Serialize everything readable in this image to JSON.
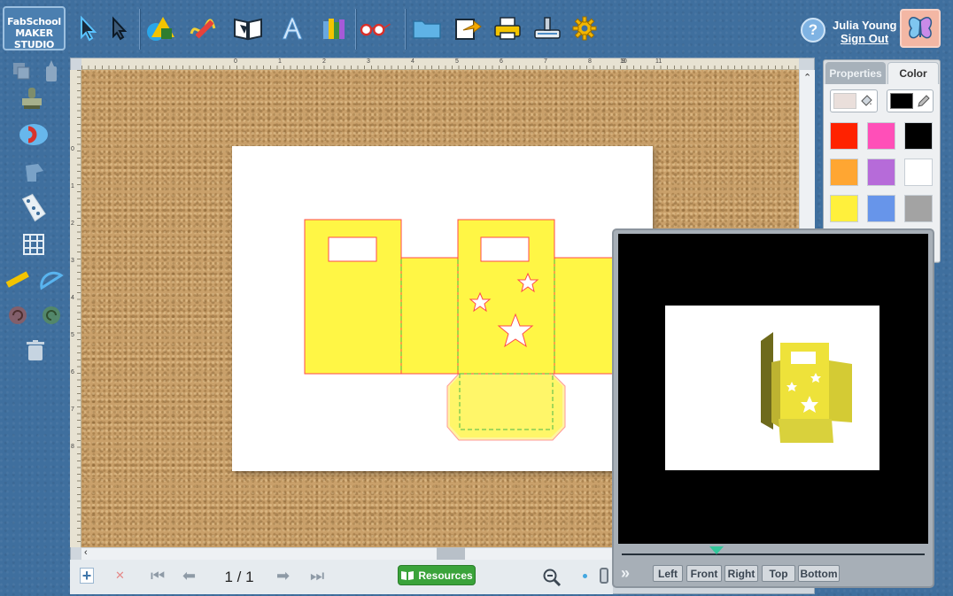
{
  "app": {
    "logo_line1": "FabSchool",
    "logo_line2": "MAKER STUDIO"
  },
  "toolbar": {
    "tools": [
      {
        "name": "select-tool",
        "icon": "arrow-pointer-icon"
      },
      {
        "name": "direct-select-tool",
        "icon": "hollow-arrow-icon"
      },
      {
        "name": "shapes-tool",
        "icon": "shapes-icon"
      },
      {
        "name": "draw-tool",
        "icon": "pencil-squiggle-icon"
      },
      {
        "name": "templates-tool",
        "icon": "open-book-icon"
      },
      {
        "name": "text-tool",
        "icon": "letter-a-icon"
      },
      {
        "name": "library-tool",
        "icon": "books-icon"
      },
      {
        "name": "3d-preview-tool",
        "icon": "3d-glasses-icon"
      },
      {
        "name": "open-tool",
        "icon": "folder-icon"
      },
      {
        "name": "export-tool",
        "icon": "export-icon"
      },
      {
        "name": "print-tool",
        "icon": "printer-icon"
      },
      {
        "name": "cut-tool",
        "icon": "cutter-machine-icon"
      },
      {
        "name": "settings-tool",
        "icon": "gear-icon"
      }
    ]
  },
  "user": {
    "help_label": "?",
    "name": "Julia Young",
    "sign_out": "Sign Out",
    "avatar_icon": "butterfly-icon"
  },
  "ruler": {
    "top_ticks": [
      "0",
      "1",
      "2",
      "3",
      "4",
      "5",
      "6",
      "7",
      "8",
      "9",
      "10",
      "11"
    ],
    "left_ticks": [
      "0",
      "1",
      "2",
      "3",
      "4",
      "5",
      "6",
      "7",
      "8"
    ]
  },
  "pagination": {
    "current": "1 / 1",
    "resources_label": "Resources"
  },
  "panel": {
    "tab_properties": "Properties",
    "tab_color": "Color",
    "fill_color": "#eadfdb",
    "stroke_color": "#000000",
    "swatches": [
      "#ff2200",
      "#ff4fb8",
      "#000000",
      "#ffa632",
      "#b66bd9",
      "#ffffff",
      "#fff03c",
      "#6795ea",
      "#a3a3a3"
    ]
  },
  "preview": {
    "views": [
      "Left",
      "Front",
      "Right",
      "Top",
      "Bottom"
    ]
  },
  "colors": {
    "template_fill": "#fff645",
    "template_stroke": "#ff4a4a",
    "fold_line": "#4ab848",
    "tab_fill": "#fff4a0"
  }
}
